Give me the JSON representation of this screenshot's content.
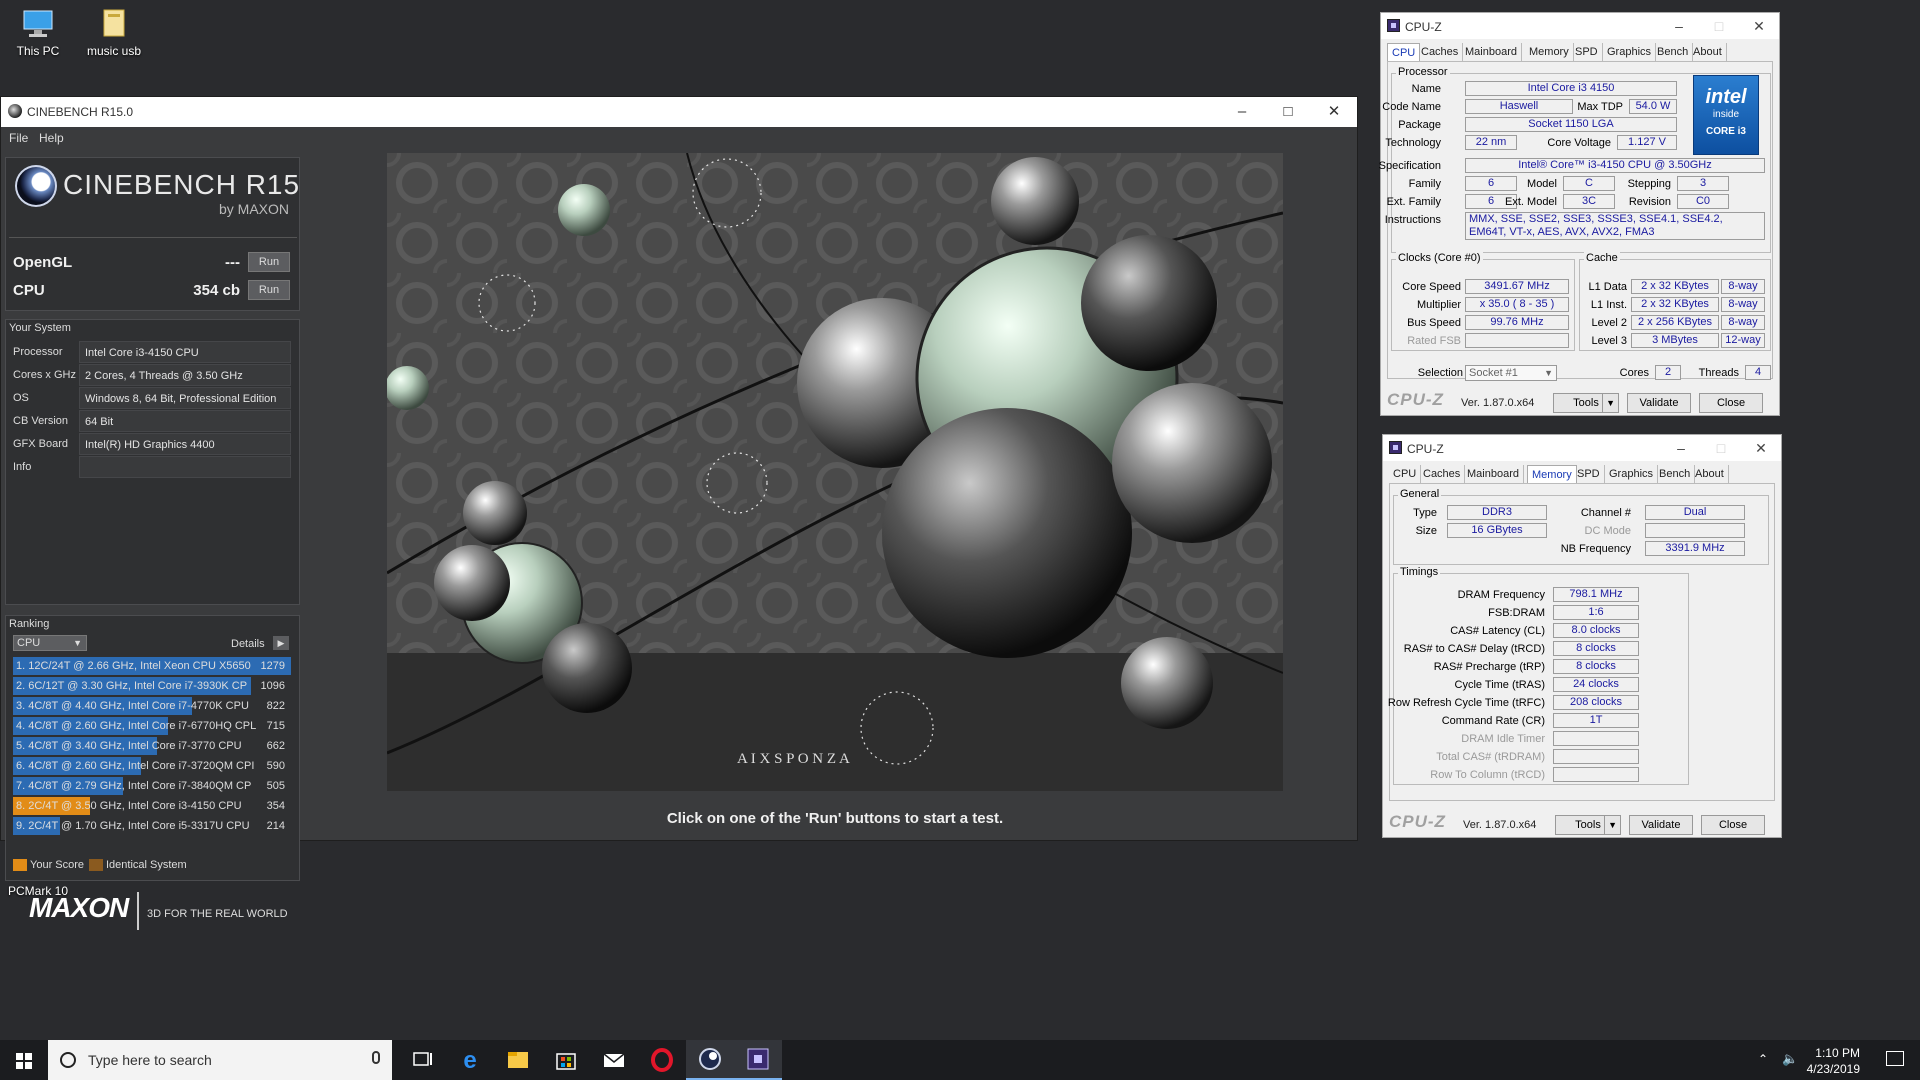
{
  "desktop": {
    "icons": [
      {
        "label": "This PC"
      },
      {
        "label": "music usb"
      },
      {
        "label": "PCMark 10"
      }
    ]
  },
  "cinebench": {
    "title": "CINEBENCH R15.0",
    "menu": [
      "File",
      "Help"
    ],
    "logo_name": "CINEBENCH R15",
    "logo_by": "by MAXON",
    "opengl": {
      "label": "OpenGL",
      "value": "---",
      "run": "Run"
    },
    "cpu": {
      "label": "CPU",
      "value": "354 cb",
      "run": "Run"
    },
    "your_system": {
      "title": "Your System",
      "rows": [
        {
          "k": "Processor",
          "v": "Intel Core i3-4150 CPU"
        },
        {
          "k": "Cores x GHz",
          "v": "2 Cores, 4 Threads @ 3.50 GHz"
        },
        {
          "k": "OS",
          "v": "Windows 8, 64 Bit, Professional Edition"
        },
        {
          "k": "CB Version",
          "v": "64 Bit"
        },
        {
          "k": "GFX Board",
          "v": "Intel(R) HD Graphics 4400"
        },
        {
          "k": "Info",
          "v": ""
        }
      ]
    },
    "ranking": {
      "title": "Ranking",
      "dropdown": "CPU",
      "details": "Details",
      "max": 1279,
      "rows": [
        {
          "text": "1. 12C/24T @ 2.66 GHz, Intel Xeon CPU X5650",
          "score": "1279",
          "value": 1279,
          "mine": false
        },
        {
          "text": "2. 6C/12T @ 3.30 GHz,  Intel Core i7-3930K CP",
          "score": "1096",
          "value": 1096,
          "mine": false
        },
        {
          "text": "3. 4C/8T @ 4.40 GHz, Intel Core i7-4770K CPU",
          "score": "822",
          "value": 822,
          "mine": false
        },
        {
          "text": "4. 4C/8T @ 2.60 GHz, Intel Core i7-6770HQ CPL",
          "score": "715",
          "value": 715,
          "mine": false
        },
        {
          "text": "5. 4C/8T @ 3.40 GHz,  Intel Core i7-3770 CPU",
          "score": "662",
          "value": 662,
          "mine": false
        },
        {
          "text": "6. 4C/8T @ 2.60 GHz, Intel Core i7-3720QM CPI",
          "score": "590",
          "value": 590,
          "mine": false
        },
        {
          "text": "7. 4C/8T @ 2.79 GHz,  Intel Core i7-3840QM CP",
          "score": "505",
          "value": 505,
          "mine": false
        },
        {
          "text": "8. 2C/4T @ 3.50 GHz, Intel Core i3-4150 CPU",
          "score": "354",
          "value": 354,
          "mine": true
        },
        {
          "text": "9. 2C/4T @ 1.70 GHz,  Intel Core i5-3317U CPU",
          "score": "214",
          "value": 214,
          "mine": false
        }
      ],
      "legend_your": "Your Score",
      "legend_identical": "Identical System"
    },
    "maxon": "MAXON",
    "tagline": "3D FOR THE REAL WORLD",
    "render_brand": "A I X S P O N Z A",
    "status": "Click on one of the 'Run' buttons to start a test."
  },
  "cpuz_cpu": {
    "title": "CPU-Z",
    "tabs": [
      "CPU",
      "Caches",
      "Mainboard",
      "Memory",
      "SPD",
      "Graphics",
      "Bench",
      "About"
    ],
    "processor_group": "Processor",
    "name_label": "Name",
    "name": "Intel Core i3 4150",
    "codename_label": "Code Name",
    "codename": "Haswell",
    "maxtdp_label": "Max TDP",
    "maxtdp": "54.0 W",
    "package_label": "Package",
    "package": "Socket 1150 LGA",
    "technology_label": "Technology",
    "technology": "22 nm",
    "corevoltage_label": "Core Voltage",
    "corevoltage": "1.127 V",
    "spec_label": "Specification",
    "spec": "Intel® Core™ i3-4150 CPU @ 3.50GHz",
    "family_label": "Family",
    "family": "6",
    "model_label": "Model",
    "model": "C",
    "stepping_label": "Stepping",
    "stepping": "3",
    "extfamily_label": "Ext. Family",
    "extfamily": "6",
    "extmodel_label": "Ext. Model",
    "extmodel": "3C",
    "revision_label": "Revision",
    "revision": "C0",
    "instr_label": "Instructions",
    "instr": "MMX, SSE, SSE2, SSE3, SSSE3, SSE4.1, SSE4.2, EM64T, VT-x, AES, AVX, AVX2, FMA3",
    "clocks_group": "Clocks (Core #0)",
    "corespeed_label": "Core Speed",
    "corespeed": "3491.67 MHz",
    "multiplier_label": "Multiplier",
    "multiplier": "x 35.0 ( 8 - 35 )",
    "busspeed_label": "Bus Speed",
    "busspeed": "99.76 MHz",
    "ratedfsb_label": "Rated FSB",
    "cache_group": "Cache",
    "l1d_label": "L1 Data",
    "l1d": "2 x 32 KBytes",
    "l1d_way": "8-way",
    "l1i_label": "L1 Inst.",
    "l1i": "2 x 32 KBytes",
    "l1i_way": "8-way",
    "l2_label": "Level 2",
    "l2": "2 x 256 KBytes",
    "l2_way": "8-way",
    "l3_label": "Level 3",
    "l3": "3 MBytes",
    "l3_way": "12-way",
    "selection_label": "Selection",
    "selection": "Socket #1",
    "cores_label": "Cores",
    "cores": "2",
    "threads_label": "Threads",
    "threads": "4",
    "intel_logo": "intel",
    "intel_inside": "inside",
    "intel_core": "CORE i3",
    "footer_logo": "CPU-Z",
    "version": "Ver. 1.87.0.x64",
    "tools": "Tools",
    "validate": "Validate",
    "close": "Close"
  },
  "cpuz_mem": {
    "title": "CPU-Z",
    "tabs": [
      "CPU",
      "Caches",
      "Mainboard",
      "Memory",
      "SPD",
      "Graphics",
      "Bench",
      "About"
    ],
    "general_group": "General",
    "type_label": "Type",
    "type": "DDR3",
    "size_label": "Size",
    "size": "16 GBytes",
    "channel_label": "Channel #",
    "channel": "Dual",
    "dcmode_label": "DC Mode",
    "nbfreq_label": "NB Frequency",
    "nbfreq": "3391.9 MHz",
    "timings_group": "Timings",
    "timings": [
      {
        "k": "DRAM Frequency",
        "v": "798.1 MHz",
        "dim": false
      },
      {
        "k": "FSB:DRAM",
        "v": "1:6",
        "dim": false
      },
      {
        "k": "CAS# Latency (CL)",
        "v": "8.0 clocks",
        "dim": false
      },
      {
        "k": "RAS# to CAS# Delay (tRCD)",
        "v": "8 clocks",
        "dim": false
      },
      {
        "k": "RAS# Precharge (tRP)",
        "v": "8 clocks",
        "dim": false
      },
      {
        "k": "Cycle Time (tRAS)",
        "v": "24 clocks",
        "dim": false
      },
      {
        "k": "Row Refresh Cycle Time (tRFC)",
        "v": "208 clocks",
        "dim": false
      },
      {
        "k": "Command Rate (CR)",
        "v": "1T",
        "dim": false
      },
      {
        "k": "DRAM Idle Timer",
        "v": "",
        "dim": true
      },
      {
        "k": "Total CAS# (tRDRAM)",
        "v": "",
        "dim": true
      },
      {
        "k": "Row To Column (tRCD)",
        "v": "",
        "dim": true
      }
    ],
    "footer_logo": "CPU-Z",
    "version": "Ver. 1.87.0.x64",
    "tools": "Tools",
    "validate": "Validate",
    "close": "Close"
  },
  "taskbar": {
    "search_placeholder": "Type here to search",
    "time": "1:10 PM",
    "date": "4/23/2019"
  },
  "colors": {
    "accent_blue": "#2c6bb3",
    "accent_orange": "#e28c17",
    "identical_brown": "#8a5a1f"
  }
}
